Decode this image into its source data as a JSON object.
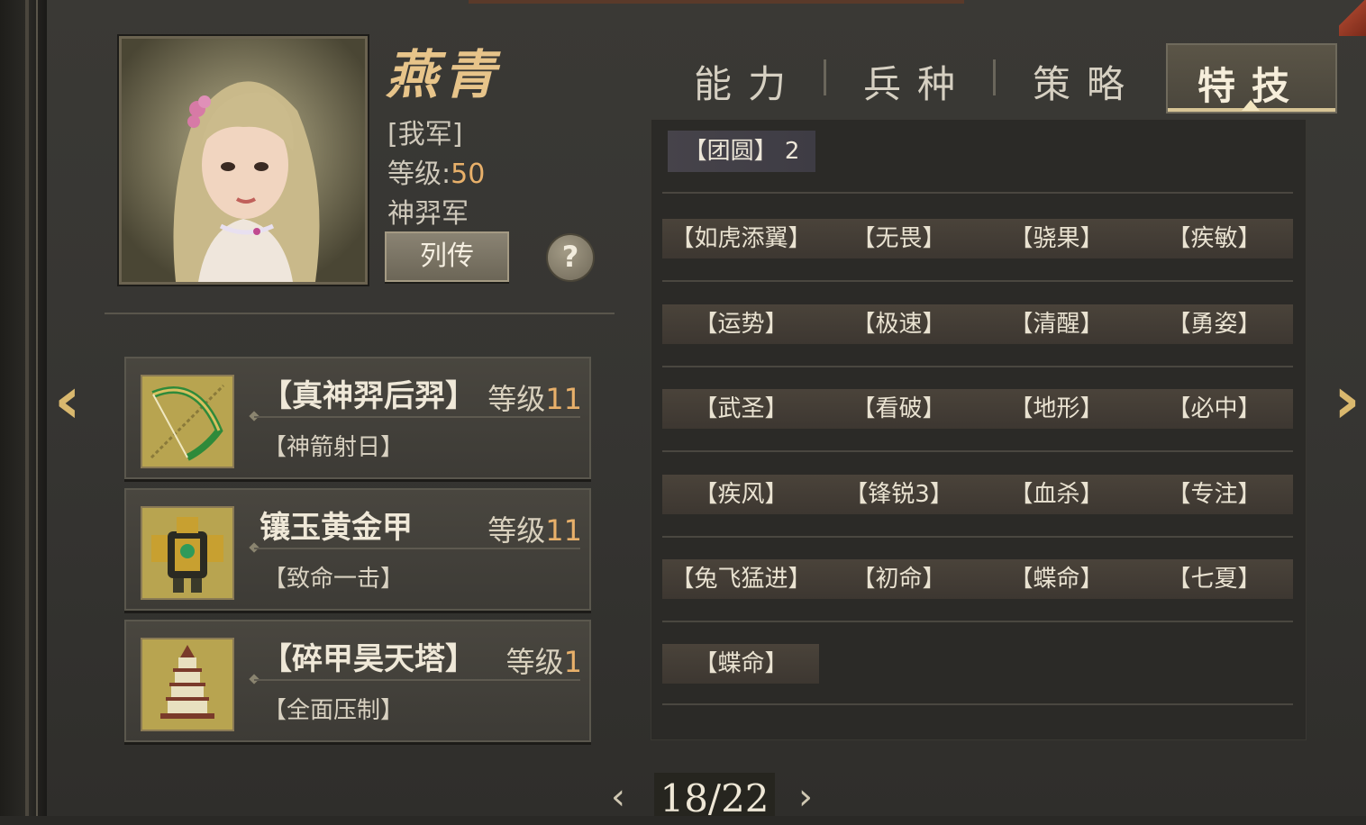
{
  "hero": {
    "name": "燕青",
    "faction": "[我军]",
    "level_label": "等级:",
    "level": "50",
    "army": "神羿军",
    "bio_button": "列传",
    "help_button": "?"
  },
  "equipment": [
    {
      "name": "【真神羿后羿】",
      "level_label": "等级",
      "level": "11",
      "skill": "【神箭射日】",
      "icon": "bow-icon"
    },
    {
      "name": "镶玉黄金甲",
      "level_label": "等级",
      "level": "11",
      "skill": "【致命一击】",
      "icon": "armor-icon"
    },
    {
      "name": "【碎甲昊天塔】",
      "level_label": "等级",
      "level": "1",
      "skill": "【全面压制】",
      "icon": "pagoda-icon"
    }
  ],
  "tabs": [
    {
      "label": "能力"
    },
    {
      "label": "兵种"
    },
    {
      "label": "策略"
    },
    {
      "label": "特技",
      "active": true
    }
  ],
  "skills": {
    "header": "【团圆】 2",
    "rows": [
      [
        "【如虎添翼】",
        "【无畏】",
        "【骁果】",
        "【疾敏】"
      ],
      [
        "【运势】",
        "【极速】",
        "【清醒】",
        "【勇姿】"
      ],
      [
        "【武圣】",
        "【看破】",
        "【地形】",
        "【必中】"
      ],
      [
        "【疾风】",
        "【锋锐3】",
        "【血杀】",
        "【专注】"
      ],
      [
        "【兔飞猛进】",
        "【初命】",
        "【蝶命】",
        "【七夏】"
      ],
      [
        "【蝶命】"
      ]
    ]
  },
  "pager": {
    "text": "18/22",
    "prev": "‹",
    "next": "›"
  },
  "nav": {
    "left_arrow": "‹",
    "right_arrow": "›"
  },
  "colors": {
    "accent_gold": "#e7c48a",
    "level_orange": "#e8b06a",
    "panel_dark": "#2b2a27"
  }
}
